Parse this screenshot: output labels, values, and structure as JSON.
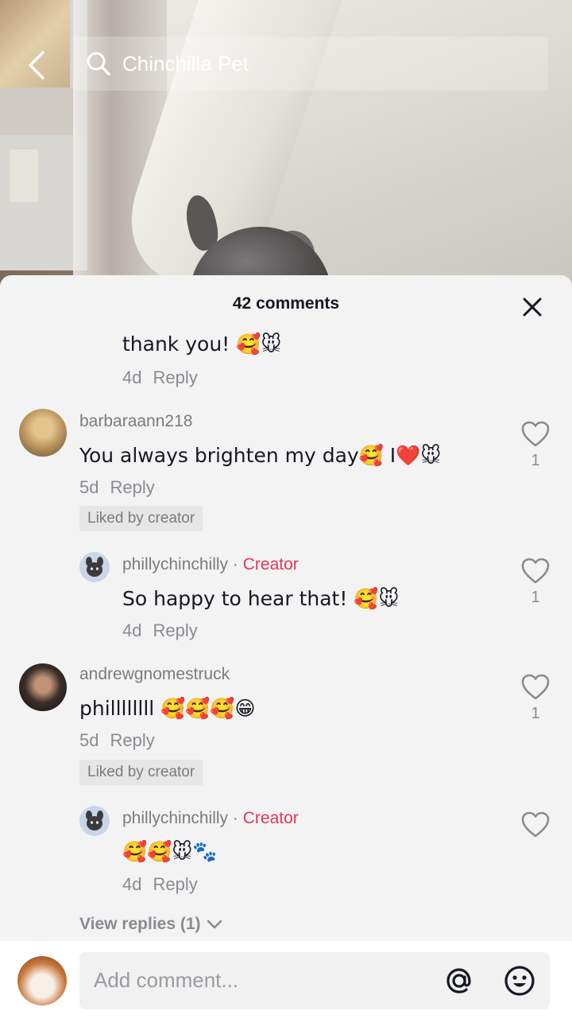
{
  "search": {
    "query": "Chinchilla Pet"
  },
  "panel": {
    "title": "42 comments"
  },
  "comments": [
    {
      "text": "thank you! 🥰🐭",
      "age": "4d",
      "reply_label": "Reply"
    },
    {
      "username": "barbaraann218",
      "text": "You always brighten my day🥰 I❤️🐭",
      "age": "5d",
      "reply_label": "Reply",
      "liked_label": "Liked by creator",
      "likes": "1"
    },
    {
      "username": "phillychinchilly",
      "separator": "·",
      "badge": "Creator",
      "text": "So happy to hear that! 🥰🐭",
      "age": "4d",
      "reply_label": "Reply",
      "likes": "1"
    },
    {
      "username": "andrewgnomestruck",
      "text": "phillllllll 🥰🥰🥰😁",
      "age": "5d",
      "reply_label": "Reply",
      "liked_label": "Liked by creator",
      "likes": "1"
    },
    {
      "username": "phillychinchilly",
      "separator": "·",
      "badge": "Creator",
      "text": "🥰🥰🐭🐾",
      "age": "4d",
      "reply_label": "Reply"
    }
  ],
  "view_replies": "View replies (1)",
  "composer": {
    "placeholder": "Add comment..."
  },
  "colors": {
    "creator": "#e1365a",
    "text": "#161823",
    "muted": "#8a8b91"
  },
  "icons": [
    "back-arrow-icon",
    "search-icon",
    "close-icon",
    "heart-icon",
    "chevron-down-icon",
    "at-mention-icon",
    "emoji-icon"
  ]
}
